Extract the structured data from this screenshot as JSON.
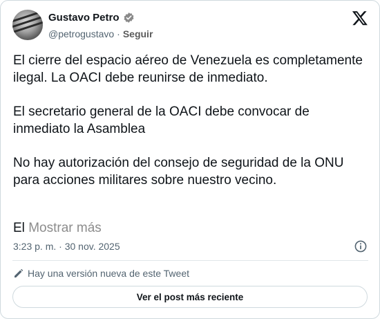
{
  "author": {
    "name": "Gustavo Petro",
    "handle": "@petrogustavo",
    "separator": "·",
    "follow_label": "Seguir"
  },
  "tweet": {
    "paragraphs": [
      "El cierre del espacio aéreo de Venezuela es completamente ilegal. La OACI debe reunirse de inmediato.",
      "El secretario general de la OACI debe convocar de inmediato la Asamblea",
      "No hay autorización del consejo de seguridad de la ONU para acciones militares sobre nuestro vecino."
    ],
    "truncated_prefix": "El",
    "show_more_label": "Mostrar más",
    "timestamp": "3:23 p. m. · 30 nov. 2025"
  },
  "update_notice": {
    "text": "Hay una versión nueva de este Tweet",
    "button_label": "Ver el post más reciente"
  },
  "icons": {
    "verified": "verified-badge-icon",
    "logo": "x-logo-icon",
    "info": "info-icon",
    "edit": "pencil-icon"
  },
  "colors": {
    "text": "#0f1419",
    "muted": "#536471",
    "border": "#cfd9de"
  }
}
